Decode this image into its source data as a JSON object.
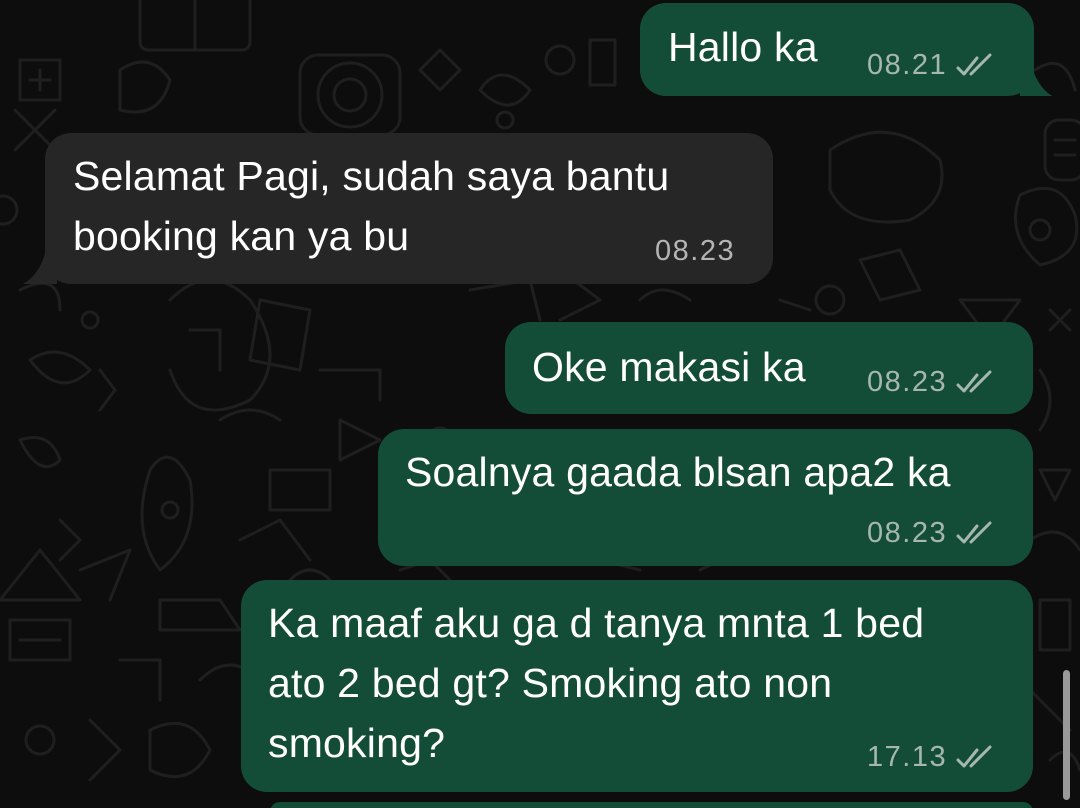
{
  "messages": [
    {
      "direction": "outgoing",
      "text_lines": [
        "Hallo ka"
      ],
      "time": "08.21",
      "status_icon": "double-check-icon"
    },
    {
      "direction": "incoming",
      "text_lines": [
        "Selamat Pagi, sudah saya bantu",
        "booking kan ya bu"
      ],
      "time": "08.23"
    },
    {
      "direction": "outgoing",
      "text_lines": [
        "Oke makasi ka"
      ],
      "time": "08.23",
      "status_icon": "double-check-icon"
    },
    {
      "direction": "outgoing",
      "text_lines": [
        "Soalnya gaada blsan apa2 ka"
      ],
      "time": "08.23",
      "status_icon": "double-check-icon"
    },
    {
      "direction": "outgoing",
      "text_lines": [
        "Ka maaf aku ga d tanya mnta 1 bed",
        "ato 2 bed gt? Smoking ato non",
        "smoking?"
      ],
      "time": "17.13",
      "status_icon": "double-check-icon"
    }
  ],
  "colors": {
    "outgoing_bubble": "#144d37",
    "incoming_bubble": "#262626",
    "background": "#0d0d0d",
    "meta_text": "#a6b8ae"
  }
}
